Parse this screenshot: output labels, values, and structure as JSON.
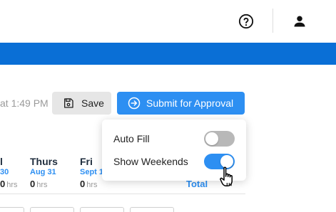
{
  "header": {
    "help_icon": "question-circle-icon",
    "user_icon": "user-icon"
  },
  "colors": {
    "brand_bar": "#0a6fd6",
    "accent": "#2d8ff2",
    "toggle_off": "#b8b8b8"
  },
  "toolbar": {
    "saved_status": "at 1:49 PM",
    "save_label": "Save",
    "save_icon": "floppy-disk-icon",
    "submit_label": "Submit for Approval",
    "submit_icon": "arrow-right-circle-icon"
  },
  "settings_popover": {
    "auto_fill": {
      "label": "Auto Fill",
      "enabled": false
    },
    "show_weekends": {
      "label": "Show Weekends",
      "enabled": true
    }
  },
  "days": [
    {
      "name": "l",
      "date": "30",
      "hours": "0",
      "unit": "hrs"
    },
    {
      "name": "Thurs",
      "date": "Aug 31",
      "hours": "0",
      "unit": "hrs"
    },
    {
      "name": "Fri",
      "date": "Sept 1",
      "hours": "0",
      "unit": "hrs"
    },
    {
      "name": "",
      "date": "",
      "hours": "0",
      "unit": "hrs"
    }
  ],
  "total_label": "Total",
  "cursor": "hand-pointer-icon"
}
